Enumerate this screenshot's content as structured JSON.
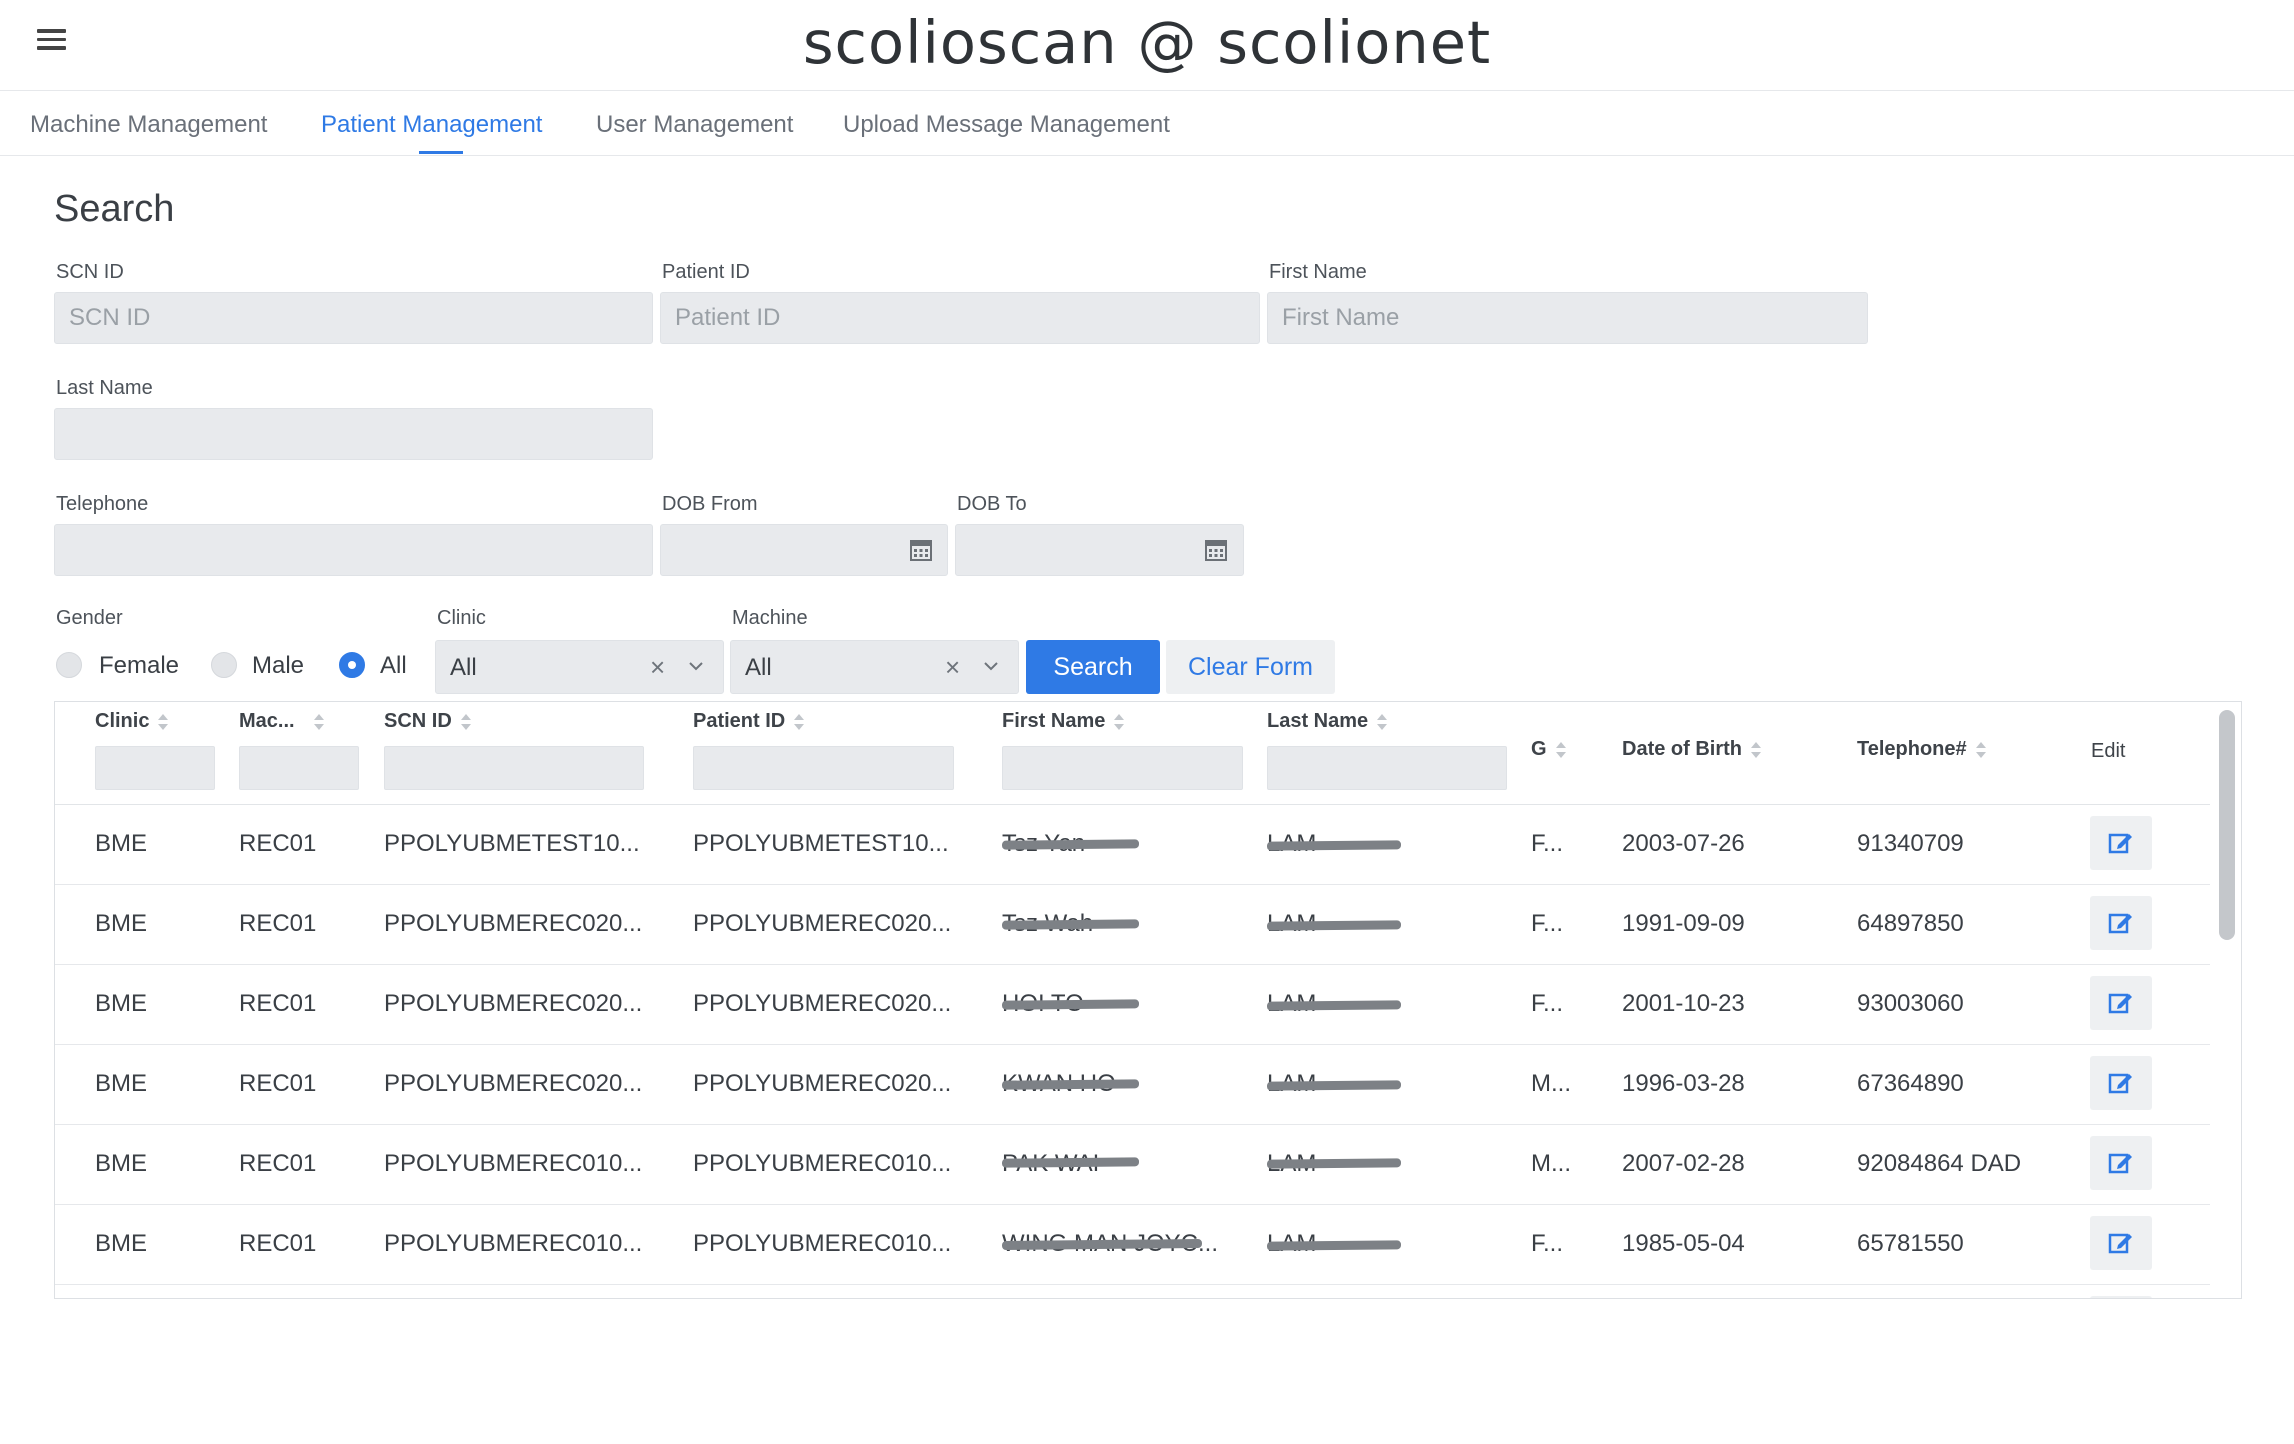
{
  "app": {
    "title": "scolioscan @ scolionet"
  },
  "tabs": [
    {
      "label": "Machine Management",
      "active": false
    },
    {
      "label": "Patient Management",
      "active": true
    },
    {
      "label": "User Management",
      "active": false
    },
    {
      "label": "Upload Message Management",
      "active": false
    }
  ],
  "search": {
    "title": "Search",
    "scn_id": {
      "label": "SCN ID",
      "placeholder": "SCN ID",
      "value": ""
    },
    "patient_id": {
      "label": "Patient ID",
      "placeholder": "Patient ID",
      "value": ""
    },
    "first_name": {
      "label": "First Name",
      "placeholder": "First Name",
      "value": ""
    },
    "last_name": {
      "label": "Last Name",
      "value": ""
    },
    "telephone": {
      "label": "Telephone",
      "value": ""
    },
    "dob_from": {
      "label": "DOB From",
      "value": ""
    },
    "dob_to": {
      "label": "DOB To",
      "value": ""
    },
    "gender": {
      "label": "Gender",
      "options": [
        "Female",
        "Male",
        "All"
      ],
      "selected": "All"
    },
    "clinic": {
      "label": "Clinic",
      "value": "All"
    },
    "machine": {
      "label": "Machine",
      "value": "All"
    },
    "search_button": "Search",
    "clear_button": "Clear Form"
  },
  "table": {
    "columns": [
      "Clinic",
      "Mac...",
      "SCN ID",
      "Patient ID",
      "First Name",
      "Last Name",
      "G",
      "Date of Birth",
      "Telephone#",
      "Edit"
    ],
    "rows": [
      {
        "clinic": "BME",
        "machine": "REC01",
        "scn_id": "PPOLYUBMETEST10...",
        "patient_id": "PPOLYUBMETEST10...",
        "first_name": "Tsz Yan",
        "last_name": "LAM",
        "gender": "F...",
        "dob": "2003-07-26",
        "telephone": "91340709"
      },
      {
        "clinic": "BME",
        "machine": "REC01",
        "scn_id": "PPOLYUBMEREC020...",
        "patient_id": "PPOLYUBMEREC020...",
        "first_name": "Tsz Wah",
        "last_name": "LAM",
        "gender": "F...",
        "dob": "1991-09-09",
        "telephone": "64897850"
      },
      {
        "clinic": "BME",
        "machine": "REC01",
        "scn_id": "PPOLYUBMEREC020...",
        "patient_id": "PPOLYUBMEREC020...",
        "first_name": "HOI TO",
        "last_name": "LAM",
        "gender": "F...",
        "dob": "2001-10-23",
        "telephone": "93003060"
      },
      {
        "clinic": "BME",
        "machine": "REC01",
        "scn_id": "PPOLYUBMEREC020...",
        "patient_id": "PPOLYUBMEREC020...",
        "first_name": "KWAN HO",
        "last_name": "LAM",
        "gender": "M...",
        "dob": "1996-03-28",
        "telephone": "67364890"
      },
      {
        "clinic": "BME",
        "machine": "REC01",
        "scn_id": "PPOLYUBMEREC010...",
        "patient_id": "PPOLYUBMEREC010...",
        "first_name": "PAK WAI",
        "last_name": "LAM",
        "gender": "M...",
        "dob": "2007-02-28",
        "telephone": "92084864 DAD"
      },
      {
        "clinic": "BME",
        "machine": "REC01",
        "scn_id": "PPOLYUBMEREC010...",
        "patient_id": "PPOLYUBMEREC010...",
        "first_name": "WING MAN JOYC...",
        "last_name": "LAM",
        "gender": "F...",
        "dob": "1985-05-04",
        "telephone": "65781550"
      }
    ]
  },
  "icons": {
    "menu": "hamburger-icon",
    "calendar": "calendar-icon",
    "clear": "close-icon",
    "dropdown": "chevron-down-icon",
    "sort": "sort-icon",
    "edit": "edit-icon"
  },
  "colors": {
    "accent": "#2f7ae5",
    "field_bg": "#e8eaed",
    "redaction": "#7d8186"
  }
}
